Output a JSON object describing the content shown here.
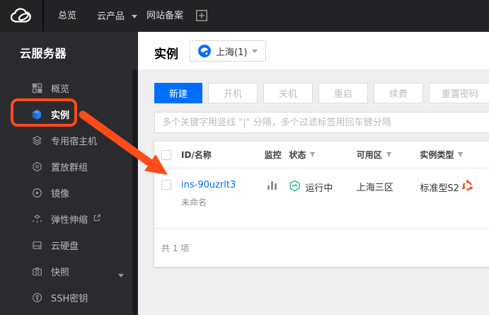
{
  "topnav": {
    "items": [
      {
        "label": "总览"
      },
      {
        "label": "云产品"
      },
      {
        "label": "网站备案"
      }
    ]
  },
  "sidebar": {
    "title": "云服务器",
    "items": [
      {
        "label": "概览"
      },
      {
        "label": "实例"
      },
      {
        "label": "专用宿主机"
      },
      {
        "label": "置放群组"
      },
      {
        "label": "镜像"
      },
      {
        "label": "弹性伸缩"
      },
      {
        "label": "云硬盘"
      },
      {
        "label": "快照"
      },
      {
        "label": "SSH密钥"
      }
    ]
  },
  "header": {
    "title": "实例",
    "region": "上海(1)"
  },
  "toolbar": {
    "create": "新建",
    "power_on": "开机",
    "power_off": "关机",
    "restart": "重启",
    "renew": "续费",
    "reset_password": "重置密码"
  },
  "search": {
    "placeholder": "多个关键字用竖线 \"|\" 分隔，多个过滤标签用回车键分隔"
  },
  "table": {
    "columns": [
      {
        "label": "ID/名称"
      },
      {
        "label": "监控"
      },
      {
        "label": "状态"
      },
      {
        "label": "可用区"
      },
      {
        "label": "实例类型"
      }
    ],
    "rows": [
      {
        "id": "ins-90uzrlt3",
        "name": "未命名",
        "status": "运行中",
        "zone": "上海三区",
        "instance_type": "标准型S2",
        "os_icon": "ubuntu-icon"
      }
    ],
    "footer": "共 1 项"
  },
  "colors": {
    "accent_blue": "#006eff",
    "annotation_orange": "#ff4c1a",
    "status_green": "#2eb87e",
    "ubuntu_orange": "#e95420",
    "sidebar_bg": "#2b2b2f",
    "topnav_bg": "#232326"
  }
}
